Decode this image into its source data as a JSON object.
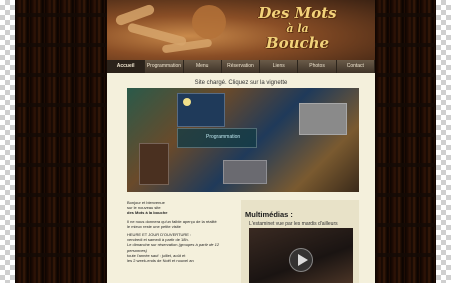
{
  "site": {
    "title_line1": "Des Mots",
    "title_line2": "à la",
    "title_line3": "Bouche"
  },
  "nav": {
    "items": [
      "Accueil",
      "Programmation",
      "Menu",
      "Réservation",
      "Liens",
      "Photos",
      "Contact"
    ],
    "active": "Accueil"
  },
  "slideshow": {
    "caption": "Site chargé. Cliquez sur la vignette",
    "overlay_label": "Programmation"
  },
  "intro": {
    "greeting": "Bonjour et bienvenue",
    "site_line": "sur le nouveau site",
    "site_name": "des Mots à la bouche",
    "overview_1": "Il ne nous donnera qu'un faible aperçu de la réalité",
    "overview_2": "le mieux reste une petite visite",
    "hours_title": "HEURE ET JOUR D'OUVERTURE :",
    "hours_1": "vendredi et samedi à partir de 18h.",
    "hours_2": "Le dimanche sur réservation",
    "hours_2b": "(groupes à partir de 12 personnes)",
    "hours_3": "toute l'année sauf : juillet, août et",
    "hours_4": "les 2 week-ends de Noël et nouvel an"
  },
  "multimedia": {
    "title": "Multimédias :",
    "subtitle": "L'estaminet vue par les mardis d'ailleurs"
  },
  "colors": {
    "page_bg": "#f4f0dc",
    "nav_bg": "#3f3428",
    "title_gold": "#f2d27a"
  }
}
